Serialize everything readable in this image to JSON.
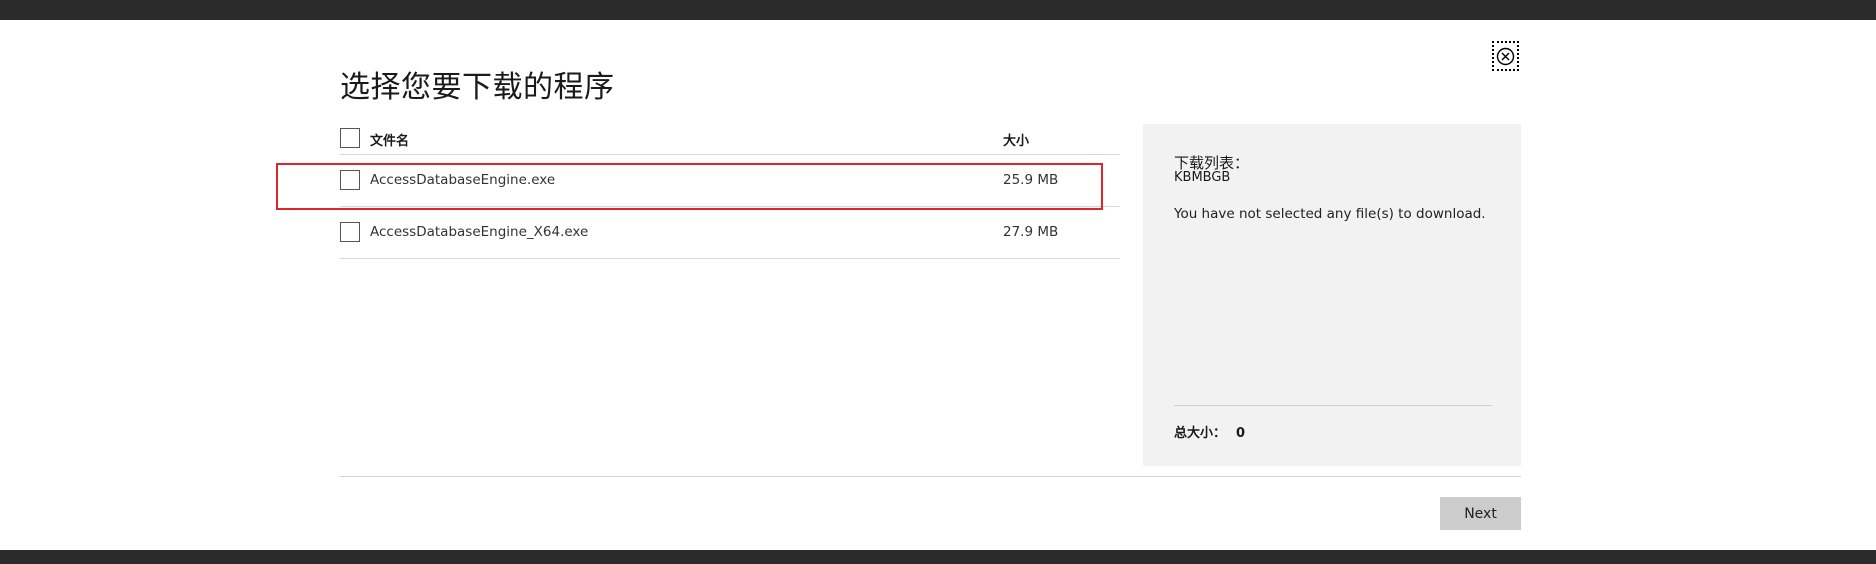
{
  "dialog": {
    "title": "选择您要下载的程序",
    "close_icon": "close-circle-icon"
  },
  "table": {
    "header": {
      "name": "文件名",
      "size": "大小"
    },
    "rows": [
      {
        "name": "AccessDatabaseEngine.exe",
        "size": "25.9 MB",
        "checked": false,
        "highlighted": true
      },
      {
        "name": "AccessDatabaseEngine_X64.exe",
        "size": "27.9 MB",
        "checked": false,
        "highlighted": false
      }
    ]
  },
  "panel": {
    "title": "下载列表：",
    "subtitle": "KBMBGB",
    "message": "You have not selected any file(s) to download.",
    "total_label": "总大小：",
    "total_value": "0"
  },
  "footer": {
    "next_label": "Next"
  },
  "colors": {
    "highlight": "#e0242b",
    "panel_bg": "#f2f2f2",
    "button_bg": "#cccccc",
    "chrome": "#2b2b2b"
  }
}
